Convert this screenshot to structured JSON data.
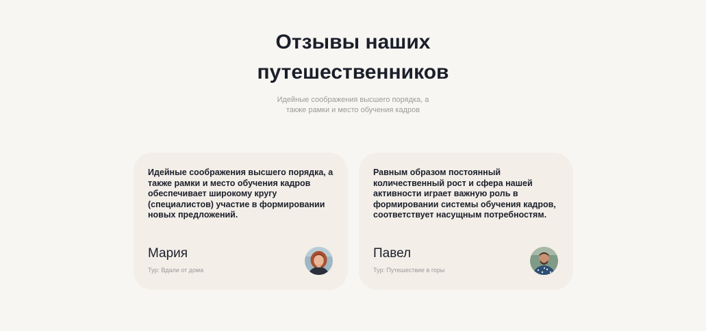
{
  "section": {
    "title_line1": "Отзывы наших",
    "title_line2": "путешественников",
    "subtitle_line1": "Идейные соображения высшего порядка, а",
    "subtitle_line2": "также рамки и место обучения кадров"
  },
  "reviews": [
    {
      "text": "Идейные соображения высшего порядка, а также рамки и место обучения кадров обеспечивает широкому кругу (специалистов) участие в формировании новых предложений.",
      "name": "Мария",
      "tour": "Тур: Вдали от дома",
      "avatar_icon": "woman-avatar"
    },
    {
      "text": "Равным образом постоянный количественный рост и сфера нашей активности играет важную роль в формировании системы обучения кадров, соответствует насущным потребностям.",
      "name": "Павел",
      "tour": "Тур: Путешествие в горы",
      "avatar_icon": "man-avatar"
    }
  ],
  "colors": {
    "background": "#f8f6f3",
    "card": "#f3eee8",
    "text": "#1b1f2a",
    "muted": "#9a9a9a"
  }
}
